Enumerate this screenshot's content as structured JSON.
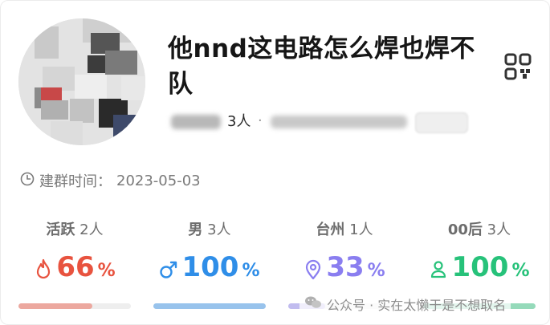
{
  "group": {
    "title": "他nnd这电路怎么焊也焊不队",
    "member_count": "3人",
    "separator": "·",
    "created_label": "建群时间：",
    "created_date": "2023-05-03"
  },
  "stats": [
    {
      "key": "active",
      "label_word": "活跃",
      "label_count": "2人",
      "icon": "flame-icon",
      "value": "66",
      "unit": "%",
      "color": "#e8533f",
      "fill": 0.66
    },
    {
      "key": "male",
      "label_word": "男",
      "label_count": "3人",
      "icon": "male-icon",
      "value": "100",
      "unit": "%",
      "color": "#2f8ee8",
      "fill": 1.0
    },
    {
      "key": "region",
      "label_word": "台州",
      "label_count": "1人",
      "icon": "location-pin-icon",
      "value": "33",
      "unit": "%",
      "color": "#8a7ef0",
      "fill": 0.33
    },
    {
      "key": "age",
      "label_word": "00后",
      "label_count": "3人",
      "icon": "person-icon",
      "value": "100",
      "unit": "%",
      "color": "#27c27a",
      "fill": 1.0
    }
  ],
  "icons": {
    "qr": "qr-code-icon",
    "clock": "clock-icon",
    "watermark": "wechat-icon"
  },
  "watermark": {
    "text": "公众号 · 实在太懒于是不想取名"
  }
}
